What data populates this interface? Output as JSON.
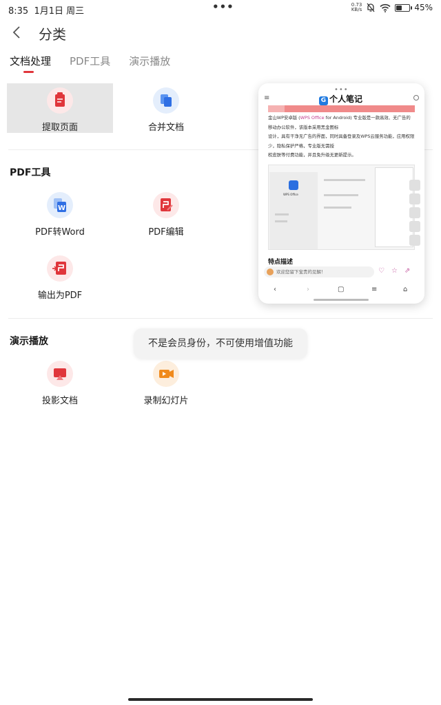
{
  "status_bar": {
    "time": "8:35",
    "date": "1月1日 周三",
    "more": "•••",
    "net_speed_top": "0.73",
    "net_speed_bottom": "KB/s",
    "battery": "45%",
    "battery_level": 0.45
  },
  "header": {
    "title": "分类"
  },
  "tabs": [
    {
      "label": "文档处理",
      "active": true
    },
    {
      "label": "PDF工具",
      "active": false
    },
    {
      "label": "演示播放",
      "active": false
    }
  ],
  "sections": {
    "doc": {
      "items": [
        {
          "label": "提取页面",
          "icon": "extract-page-icon",
          "selected": true
        },
        {
          "label": "合并文档",
          "icon": "merge-document-icon",
          "selected": false
        }
      ]
    },
    "pdf": {
      "title": "PDF工具",
      "items": [
        {
          "label": "PDF转Word",
          "icon": "pdf-to-word-icon"
        },
        {
          "label": "PDF编辑",
          "icon": "pdf-edit-icon"
        },
        {
          "label": "输出为PDF",
          "icon": "export-pdf-icon"
        }
      ]
    },
    "present": {
      "title": "演示播放",
      "items": [
        {
          "label": "投影文档",
          "icon": "projection-icon"
        },
        {
          "label": "录制幻灯片",
          "icon": "record-slides-icon"
        }
      ]
    }
  },
  "preview": {
    "site_name": "个人笔记",
    "site_badge": "G",
    "paragraph_1a": "金山WP安卓版 (",
    "paragraph_1_wps": "WPS Office",
    "paragraph_1b": " for Android) 专业版是一款高效、无广告的移动办公软件，该版本采用黑金图标",
    "paragraph_2": "设计，具有干净无广告的界面，同时具备登录及WPS云服务功能，应用权限少，隐私保护严格，专业版无需授",
    "paragraph_3": "权皮肤等付费功能，并且免升级无更新提示。",
    "screenshot_app_name": "WPS Office",
    "section_heading": "特点描述",
    "comment_placeholder": "欢迎您留下宝贵的见解！"
  },
  "toast": {
    "message": "不是会员身份，不可使用增值功能"
  },
  "colors": {
    "accent": "#e0363b",
    "blue": "#2f6fe4",
    "orange": "#f08a1c"
  }
}
